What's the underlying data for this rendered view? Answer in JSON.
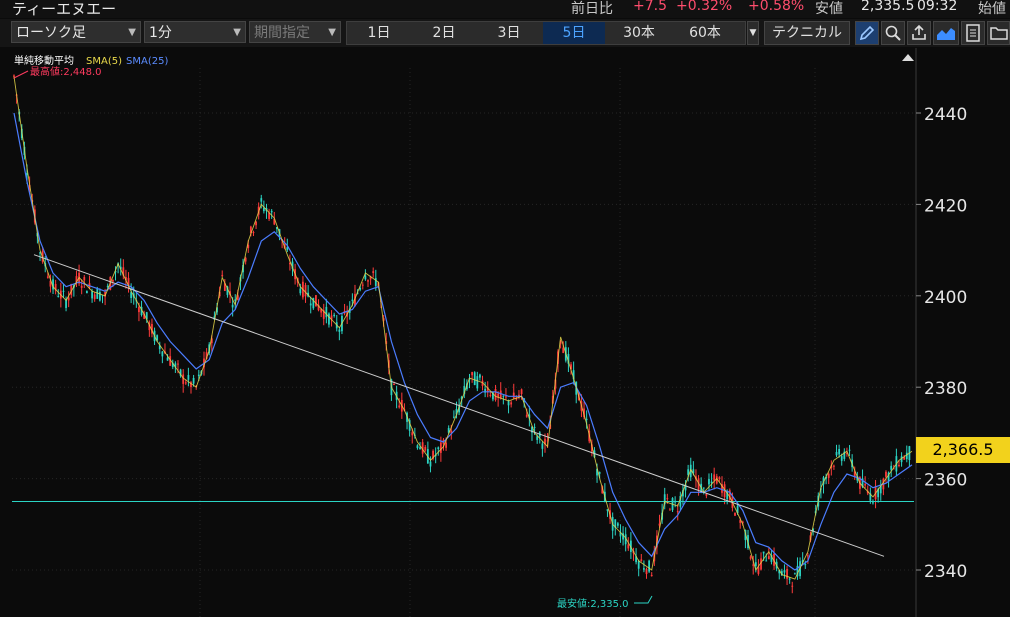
{
  "header": {
    "stock_name": "ティーエヌエー",
    "prev_label": "前日比",
    "change": "+7.5",
    "change_pct": "+0.32%",
    "change_pct2": "+0.58%",
    "low_label": "安値",
    "low_value": "2,335.5",
    "time": "09:32",
    "open_label": "始値"
  },
  "toolbar": {
    "chart_type": "ローソク足",
    "interval": "1分",
    "date_range_placeholder": "期間指定",
    "periods": [
      "1日",
      "2日",
      "3日",
      "5日",
      "30本",
      "60本"
    ],
    "active_period": "5日",
    "technical_label": "テクニカル",
    "icons": [
      "pencil-icon",
      "zoom-icon",
      "export-icon",
      "area-chart-icon",
      "memo-icon",
      "folder-icon"
    ]
  },
  "legend": {
    "indicator": "単純移動平均",
    "sma5": "SMA(5)",
    "sma25": "SMA(25)",
    "high_label": "最高値:2,448.0",
    "low_label": "最安値:2,335.0"
  },
  "axis": {
    "ticks": [
      "2440",
      "2420",
      "2400",
      "2380",
      "2360",
      "2340"
    ],
    "current_price": "2,366.5"
  },
  "colors": {
    "up": "#ff3b3b",
    "down": "#2bd4c4",
    "sma5": "#e8d84a",
    "sma25": "#4b7dff",
    "price_tag": "#f2d21c",
    "active_period": "#0d2a52",
    "positive": "#ff4d6d"
  },
  "chart_data": {
    "type": "line",
    "title": "",
    "xlabel": "",
    "ylabel": "",
    "ylim": [
      2332,
      2450
    ],
    "grid": true,
    "series": [
      {
        "name": "SMA(5)",
        "values": [
          2448,
          2428,
          2410,
          2402,
          2399,
          2404,
          2401,
          2400,
          2407,
          2401,
          2396,
          2390,
          2386,
          2382,
          2380,
          2388,
          2404,
          2398,
          2412,
          2420,
          2417,
          2409,
          2402,
          2399,
          2396,
          2393,
          2398,
          2405,
          2403,
          2380,
          2375,
          2368,
          2364,
          2367,
          2374,
          2382,
          2381,
          2378,
          2377,
          2378,
          2370,
          2367,
          2391,
          2382,
          2372,
          2360,
          2350,
          2347,
          2342,
          2340,
          2355,
          2354,
          2362,
          2357,
          2360,
          2356,
          2350,
          2340,
          2344,
          2339,
          2338,
          2344,
          2358,
          2364,
          2366,
          2359,
          2356,
          2360,
          2364,
          2366
        ]
      },
      {
        "name": "SMA(25)",
        "values": [
          2440,
          2425,
          2412,
          2405,
          2402,
          2403,
          2402,
          2401,
          2403,
          2402,
          2399,
          2394,
          2390,
          2387,
          2384,
          2386,
          2394,
          2397,
          2404,
          2412,
          2414,
          2411,
          2406,
          2402,
          2399,
          2396,
          2397,
          2401,
          2402,
          2390,
          2381,
          2374,
          2369,
          2368,
          2371,
          2377,
          2379,
          2379,
          2378,
          2378,
          2374,
          2371,
          2380,
          2381,
          2376,
          2367,
          2357,
          2351,
          2346,
          2343,
          2349,
          2352,
          2357,
          2357,
          2358,
          2357,
          2353,
          2346,
          2345,
          2342,
          2340,
          2342,
          2350,
          2357,
          2361,
          2360,
          2358,
          2359,
          2361,
          2363
        ]
      },
      {
        "name": "trendline",
        "values": [
          2409,
          2343
        ]
      },
      {
        "name": "horizontal-line",
        "values": [
          2355
        ]
      }
    ]
  }
}
